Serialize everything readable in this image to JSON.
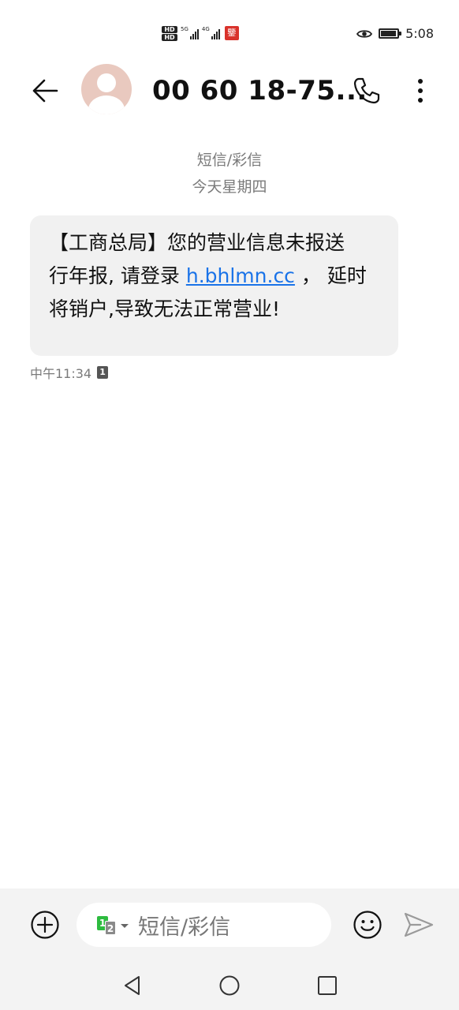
{
  "status_bar": {
    "hd_top": "HD",
    "hd_bottom": "HD",
    "net1": "5G",
    "net2": "4G",
    "badge": "鑒",
    "time": "5:08",
    "battery_level": 0.85
  },
  "header": {
    "contact_name": "00 60 18-75..."
  },
  "thread": {
    "type_label": "短信/彩信",
    "date_label": "今天星期四"
  },
  "message": {
    "line1": "【工商总局】您的营业信息未报送",
    "line2_pre": "行年报, 请登录 ",
    "line2_link": "h.bhlmn.cc",
    "line2_post": " ，  延时",
    "line3": "将销户,导致无法正常营业!",
    "time": "中午11:34",
    "sim": "1"
  },
  "compose": {
    "sim_primary": "1",
    "sim_secondary": "2",
    "placeholder": "短信/彩信"
  },
  "colors": {
    "link": "#1a73e8",
    "bubble_bg": "#f1f1f1",
    "avatar_bg": "#e9c9bf",
    "sim_green": "#2dbb3f"
  },
  "icons": {
    "back": "arrow-left-icon",
    "call": "phone-icon",
    "more": "more-vertical-icon",
    "add": "plus-circle-icon",
    "emoji": "smiley-icon",
    "send": "send-icon",
    "nav_back": "triangle-back-icon",
    "nav_home": "circle-home-icon",
    "nav_recent": "square-recent-icon"
  }
}
